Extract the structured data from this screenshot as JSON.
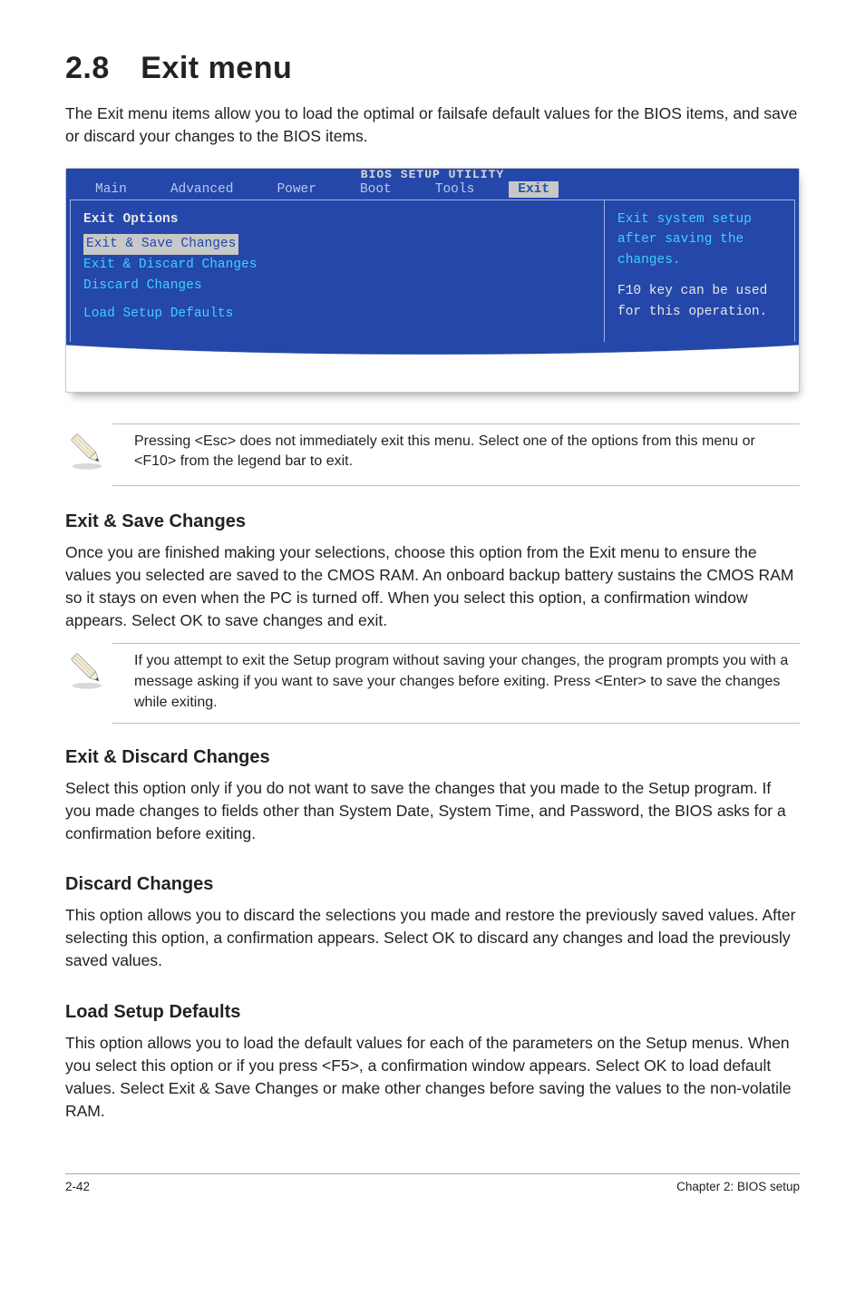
{
  "heading": "2.8 Exit menu",
  "intro": "The Exit menu items allow you to load the optimal or failsafe default values for the BIOS items, and save or discard your changes to the BIOS items.",
  "bios": {
    "title": "BIOS SETUP UTILITY",
    "tabs": [
      "Main",
      "Advanced",
      "Power",
      "Boot",
      "Tools",
      "Exit"
    ],
    "active_tab": "Exit",
    "left": {
      "section": "Exit Options",
      "selected": "Exit & Save Changes",
      "opts": [
        "Exit & Discard Changes",
        "Discard Changes"
      ],
      "after_gap": "Load Setup Defaults"
    },
    "right": {
      "help1": "Exit system setup after saving the changes.",
      "help2": "F10 key can be used for this operation."
    }
  },
  "note1": "Pressing <Esc> does not immediately exit this menu. Select one of the options from this menu or <F10> from the legend bar to exit.",
  "sec": [
    {
      "h": "Exit & Save Changes",
      "p": "Once you are finished making your selections, choose this option from the Exit menu to ensure the values you selected are saved to the CMOS RAM. An onboard backup battery sustains the CMOS RAM so it stays on even when the PC is turned off. When you select this option, a confirmation window appears. Select OK to save changes and exit."
    },
    {
      "h": "Exit & Discard Changes",
      "p": "Select this option only if you do not want to save the changes that you  made to the Setup program. If you made changes to fields other than System Date, System Time, and Password, the BIOS asks for a confirmation before exiting."
    },
    {
      "h": "Discard Changes",
      "p": "This option allows you to discard the selections you made and restore the previously saved values. After selecting this option, a confirmation appears. Select OK to discard any changes and load the previously saved values."
    },
    {
      "h": "Load Setup Defaults",
      "p": "This option allows you to load the default values for each of the parameters on the Setup menus. When you select this option or if you press <F5>, a confirmation window appears. Select OK to load default values. Select Exit & Save Changes or make other changes before saving the values to the non-volatile RAM."
    }
  ],
  "note2": " If you attempt to exit the Setup program without saving your changes, the program prompts you with a message asking if you want to save your changes before exiting. Press <Enter>  to save the  changes while exiting.",
  "footer": {
    "left": "2-42",
    "right": "Chapter 2: BIOS setup"
  }
}
